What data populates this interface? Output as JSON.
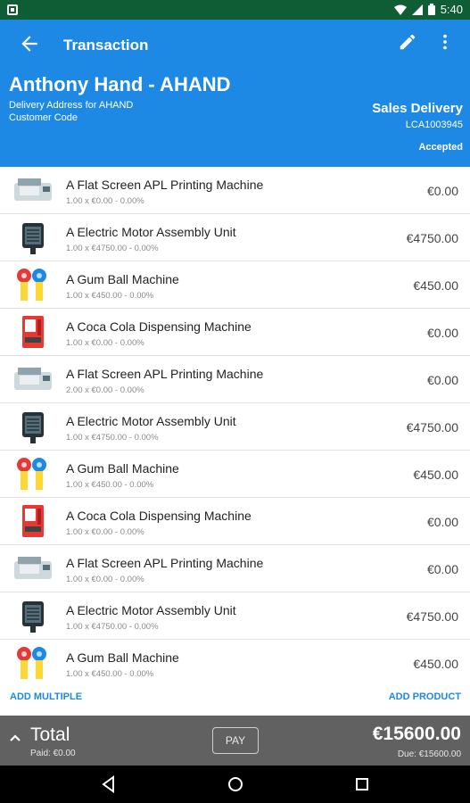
{
  "status_bar": {
    "time": "5:40"
  },
  "header": {
    "title": "Transaction",
    "customer": "Anthony Hand - AHAND",
    "delivery_address": "Delivery Address for AHAND",
    "customer_code": "Customer Code",
    "doc_type": "Sales Delivery",
    "doc_number": "LCA1003945",
    "status": "Accepted"
  },
  "items": [
    {
      "name": "A Flat Screen APL Printing Machine",
      "detail": "1.00 x €0.00 - 0.00%",
      "amount": "€0.00",
      "icon": "printing-machine"
    },
    {
      "name": "A Electric Motor Assembly Unit",
      "detail": "1.00 x €4750.00 - 0.00%",
      "amount": "€4750.00",
      "icon": "motor-unit"
    },
    {
      "name": "A Gum Ball Machine",
      "detail": "1.00 x €450.00 - 0.00%",
      "amount": "€450.00",
      "icon": "gumball-machine"
    },
    {
      "name": "A Coca Cola Dispensing Machine",
      "detail": "1.00 x €0.00 - 0.00%",
      "amount": "€0.00",
      "icon": "dispensing-machine"
    },
    {
      "name": "A Flat Screen APL Printing Machine",
      "detail": "2.00 x €0.00 - 0.00%",
      "amount": "€0.00",
      "icon": "printing-machine"
    },
    {
      "name": "A Electric Motor Assembly Unit",
      "detail": "1.00 x €4750.00 - 0.00%",
      "amount": "€4750.00",
      "icon": "motor-unit"
    },
    {
      "name": "A Gum Ball Machine",
      "detail": "1.00 x €450.00 - 0.00%",
      "amount": "€450.00",
      "icon": "gumball-machine"
    },
    {
      "name": "A Coca Cola Dispensing Machine",
      "detail": "1.00 x €0.00 - 0.00%",
      "amount": "€0.00",
      "icon": "dispensing-machine"
    },
    {
      "name": "A Flat Screen APL Printing Machine",
      "detail": "1.00 x €0.00 - 0.00%",
      "amount": "€0.00",
      "icon": "printing-machine"
    },
    {
      "name": "A Electric Motor Assembly Unit",
      "detail": "1.00 x €4750.00 - 0.00%",
      "amount": "€4750.00",
      "icon": "motor-unit"
    },
    {
      "name": "A Gum Ball Machine",
      "detail": "1.00 x €450.00 - 0.00%",
      "amount": "€450.00",
      "icon": "gumball-machine"
    }
  ],
  "actions": {
    "add_multiple": "ADD MULTIPLE",
    "add_product": "ADD PRODUCT"
  },
  "totals": {
    "label": "Total",
    "paid": "Paid: €0.00",
    "pay_button": "PAY",
    "amount": "€15600.00",
    "due": "Due: €15600.00"
  },
  "colors": {
    "status_bar": "#0f5d35",
    "header": "#1e88e5",
    "accent": "#1e88e5",
    "total_bar": "#616161"
  }
}
